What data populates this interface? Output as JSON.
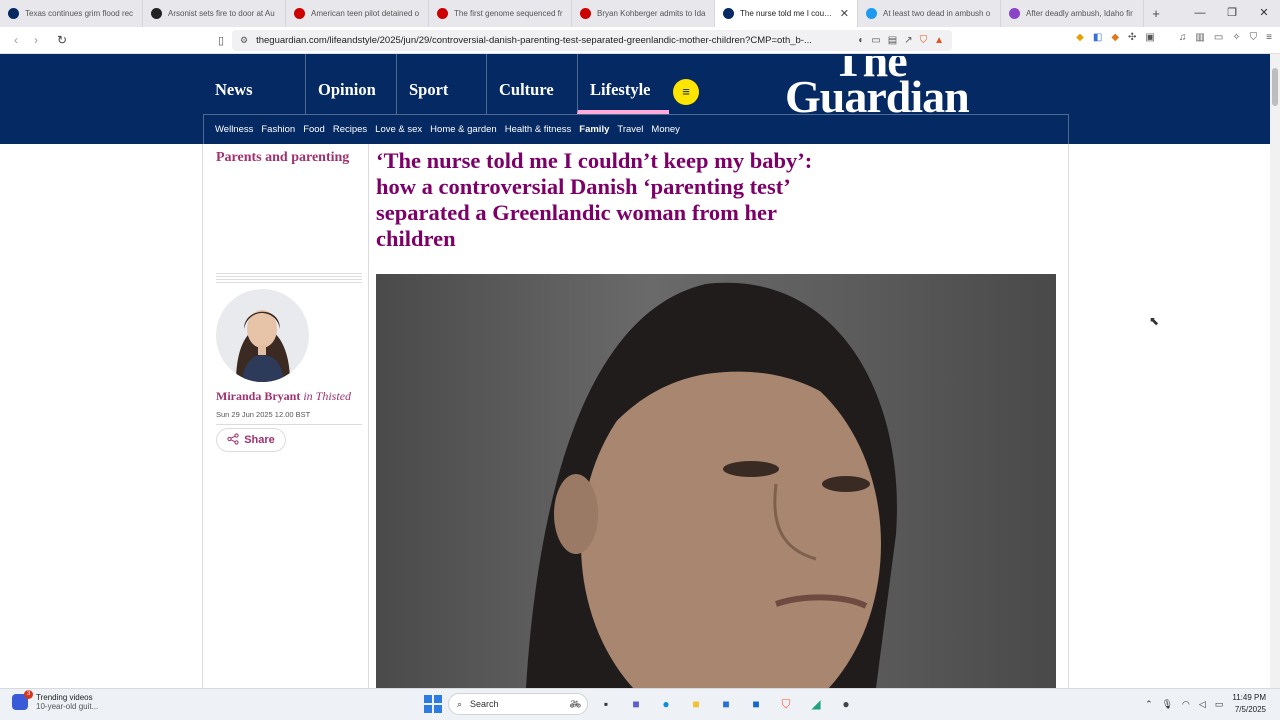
{
  "browser": {
    "tabs": [
      {
        "title": "Texas continues grim flood rec",
        "fav_color": "#052962",
        "active": false
      },
      {
        "title": "Arsonist sets fire to door at Au",
        "fav_color": "#222222",
        "active": false
      },
      {
        "title": "American teen pilot detained o",
        "fav_color": "#cc0000",
        "active": false
      },
      {
        "title": "The first genome sequenced fr",
        "fav_color": "#cc0000",
        "active": false
      },
      {
        "title": "Bryan Kohberger admits to Ida",
        "fav_color": "#cc0000",
        "active": false
      },
      {
        "title": "The nurse told me I couldn",
        "fav_color": "#052962",
        "active": true
      },
      {
        "title": "At least two dead in ambush o",
        "fav_color": "#1d9bf0",
        "active": false
      },
      {
        "title": "After deadly ambush, Idaho fir",
        "fav_color": "#8a44c8",
        "active": false
      }
    ],
    "url": "theguardian.com/lifeandstyle/2025/jun/29/controversial-danish-parenting-test-separated-greenlandic-mother-children?CMP=oth_b-..."
  },
  "header": {
    "pillars": [
      "News",
      "Opinion",
      "Sport",
      "Culture",
      "Lifestyle"
    ],
    "logo_line1": "The",
    "logo_line2": "Guardian",
    "subnav": [
      "Wellness",
      "Fashion",
      "Food",
      "Recipes",
      "Love & sex",
      "Home & garden",
      "Health & fitness",
      "Family",
      "Travel",
      "Money"
    ]
  },
  "article": {
    "section": "Parents and parenting",
    "headline": "‘The nurse told me I couldn’t keep my baby’: how a controversial Danish ‘parenting test’ separated a Greenlandic woman from her children",
    "author": "Miranda Bryant",
    "location": "in Thisted",
    "date": "Sun 29 Jun 2025 12.00 BST",
    "share_label": "Share"
  },
  "taskbar": {
    "trending_title": "Trending videos",
    "trending_sub": "10-year-old guit...",
    "trending_badge": "3",
    "search_label": "Search",
    "time": "11:49 PM",
    "date": "7/5/2025"
  },
  "colors": {
    "guardian_blue": "#052962",
    "lifestyle_purple": "#7d0068",
    "byline_pink": "#a1306e",
    "menu_yellow": "#ffe500"
  }
}
